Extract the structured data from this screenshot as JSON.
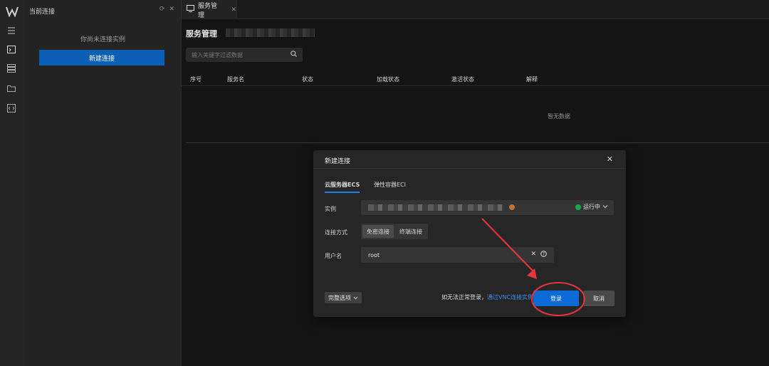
{
  "sidebar": {
    "title": "当前连接",
    "empty_text": "你尚未连接实例",
    "new_button": "新建连接"
  },
  "tabs": [
    {
      "label": "服务管理"
    }
  ],
  "main": {
    "title": "服务管理",
    "search_placeholder": "输入关键字过滤数据",
    "columns": [
      "序号",
      "服务名",
      "状态",
      "加载状态",
      "激活状态",
      "解释"
    ],
    "empty": "暂无数据"
  },
  "dialog": {
    "title": "新建连接",
    "tabs": [
      "云服务器ECS",
      "弹性容器ECI"
    ],
    "instance_label": "实例",
    "instance_status": "运行中",
    "method_label": "连接方式",
    "methods": [
      "免密连接",
      "终端连接"
    ],
    "username_label": "用户名",
    "username_value": "root",
    "advanced": "完整选项",
    "hint_prefix": "如无法正常登录，",
    "hint_link": "通过VNC连接实例",
    "login": "登录",
    "cancel": "取消"
  },
  "colors": {
    "accent": "#0b6ad6",
    "link": "#3b8ff0",
    "running": "#1aa846",
    "annotation": "#e8353a"
  }
}
